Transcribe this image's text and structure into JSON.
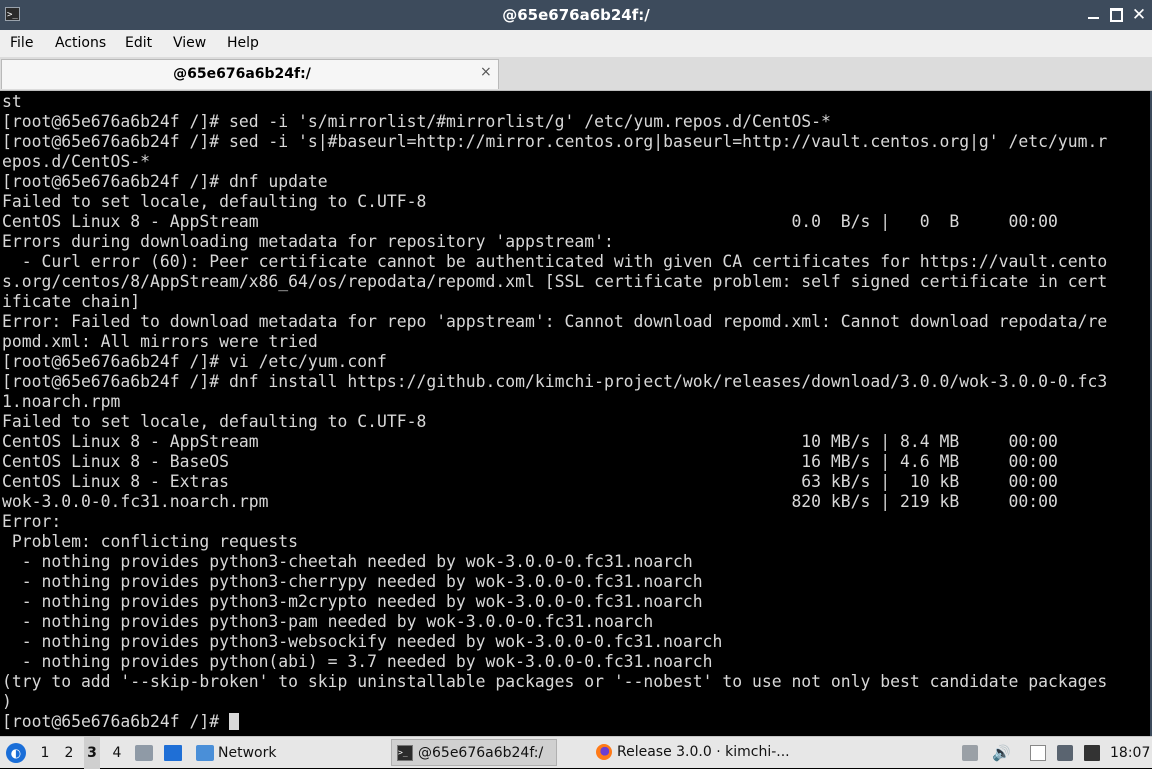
{
  "window": {
    "title": "@65e676a6b24f:/",
    "minimize_icon": "minimize-icon",
    "maximize_icon": "maximize-icon",
    "close_icon": "close-icon",
    "close_glyph": "✕"
  },
  "menu": {
    "file": "File",
    "actions": "Actions",
    "edit": "Edit",
    "view": "View",
    "help": "Help"
  },
  "tab": {
    "label": "@65e676a6b24f:/",
    "close_glyph": "×"
  },
  "terminal": {
    "lines": [
      "st",
      "[root@65e676a6b24f /]# sed -i 's/mirrorlist/#mirrorlist/g' /etc/yum.repos.d/CentOS-*",
      "[root@65e676a6b24f /]# sed -i 's|#baseurl=http://mirror.centos.org|baseurl=http://vault.centos.org|g' /etc/yum.r",
      "epos.d/CentOS-*",
      "[root@65e676a6b24f /]# dnf update",
      "Failed to set locale, defaulting to C.UTF-8",
      "CentOS Linux 8 - AppStream                                                      0.0  B/s |   0  B     00:00",
      "Errors during downloading metadata for repository 'appstream':",
      "  - Curl error (60): Peer certificate cannot be authenticated with given CA certificates for https://vault.cento",
      "s.org/centos/8/AppStream/x86_64/os/repodata/repomd.xml [SSL certificate problem: self signed certificate in cert",
      "ificate chain]",
      "Error: Failed to download metadata for repo 'appstream': Cannot download repomd.xml: Cannot download repodata/re",
      "pomd.xml: All mirrors were tried",
      "[root@65e676a6b24f /]# vi /etc/yum.conf",
      "[root@65e676a6b24f /]# dnf install https://github.com/kimchi-project/wok/releases/download/3.0.0/wok-3.0.0-0.fc3",
      "1.noarch.rpm",
      "Failed to set locale, defaulting to C.UTF-8",
      "CentOS Linux 8 - AppStream                                                       10 MB/s | 8.4 MB     00:00",
      "CentOS Linux 8 - BaseOS                                                          16 MB/s | 4.6 MB     00:00",
      "CentOS Linux 8 - Extras                                                          63 kB/s |  10 kB     00:00",
      "wok-3.0.0-0.fc31.noarch.rpm                                                     820 kB/s | 219 kB     00:00",
      "Error:",
      " Problem: conflicting requests",
      "  - nothing provides python3-cheetah needed by wok-3.0.0-0.fc31.noarch",
      "  - nothing provides python3-cherrypy needed by wok-3.0.0-0.fc31.noarch",
      "  - nothing provides python3-m2crypto needed by wok-3.0.0-0.fc31.noarch",
      "  - nothing provides python3-pam needed by wok-3.0.0-0.fc31.noarch",
      "  - nothing provides python3-websockify needed by wok-3.0.0-0.fc31.noarch",
      "  - nothing provides python(abi) = 3.7 needed by wok-3.0.0-0.fc31.noarch",
      "(try to add '--skip-broken' to skip uninstallable packages or '--nobest' to use not only best candidate packages",
      ")"
    ],
    "prompt": "[root@65e676a6b24f /]# "
  },
  "taskbar": {
    "workspaces": [
      "1",
      "2",
      "3",
      "4"
    ],
    "active_workspace": "3",
    "network_label": "Network",
    "task_terminal": "@65e676a6b24f:/",
    "task_firefox": "Release 3.0.0 · kimchi-...",
    "clock": "18:07"
  }
}
